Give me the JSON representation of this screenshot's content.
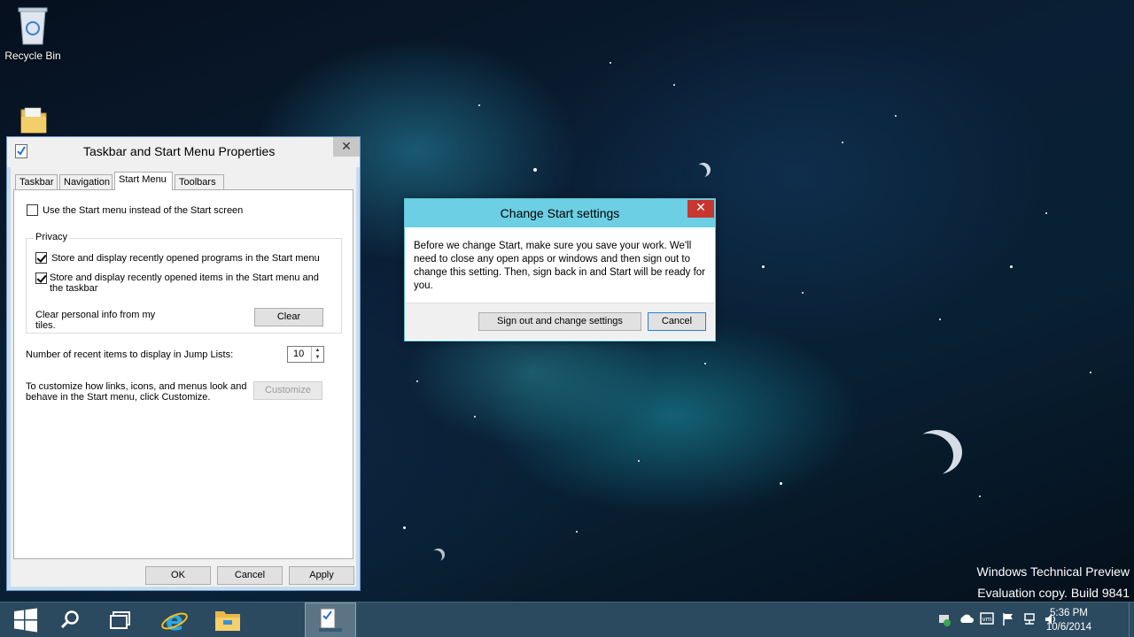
{
  "desktop": {
    "recycle_bin": "Recycle Bin",
    "watermark": {
      "line1": "Windows Technical Preview",
      "line2": "Evaluation copy. Build 9841"
    }
  },
  "properties_window": {
    "title": "Taskbar and Start Menu Properties",
    "close": "✕",
    "tabs": [
      {
        "label": "Taskbar",
        "active": false
      },
      {
        "label": "Navigation",
        "active": false
      },
      {
        "label": "Start Menu",
        "active": true
      },
      {
        "label": "Toolbars",
        "active": false
      }
    ],
    "use_start_menu": {
      "label": "Use the Start menu instead of the Start screen",
      "checked": false
    },
    "privacy": {
      "legend": "Privacy",
      "store_programs": {
        "label": "Store and display recently opened programs in the Start menu",
        "checked": true
      },
      "store_items": {
        "label": "Store and display recently opened items in the Start menu and the taskbar",
        "checked": true
      },
      "clear_info": "Clear personal info from my tiles.",
      "clear_button": "Clear"
    },
    "jump_lists": {
      "label": "Number of recent items to display in Jump Lists:",
      "value": "10"
    },
    "customize": {
      "label": "To customize how links, icons, and menus look and behave in the Start menu, click Customize.",
      "button": "Customize"
    },
    "buttons": {
      "ok": "OK",
      "cancel": "Cancel",
      "apply": "Apply"
    }
  },
  "change_start_dialog": {
    "title": "Change Start settings",
    "close": "✕",
    "message": "Before we change Start, make sure you save your work. We'll need to close any open apps or windows and then sign out to change this setting. Then, sign back in and Start will be ready for you.",
    "sign_out_button": "Sign out and change settings",
    "cancel_button": "Cancel"
  },
  "taskbar": {
    "clock_time": "5:36 PM",
    "clock_date": "10/6/2014"
  },
  "colors": {
    "dialog_title": "#6ccfe3",
    "close_red": "#c7372f",
    "taskbar": "#2c4a5f"
  }
}
